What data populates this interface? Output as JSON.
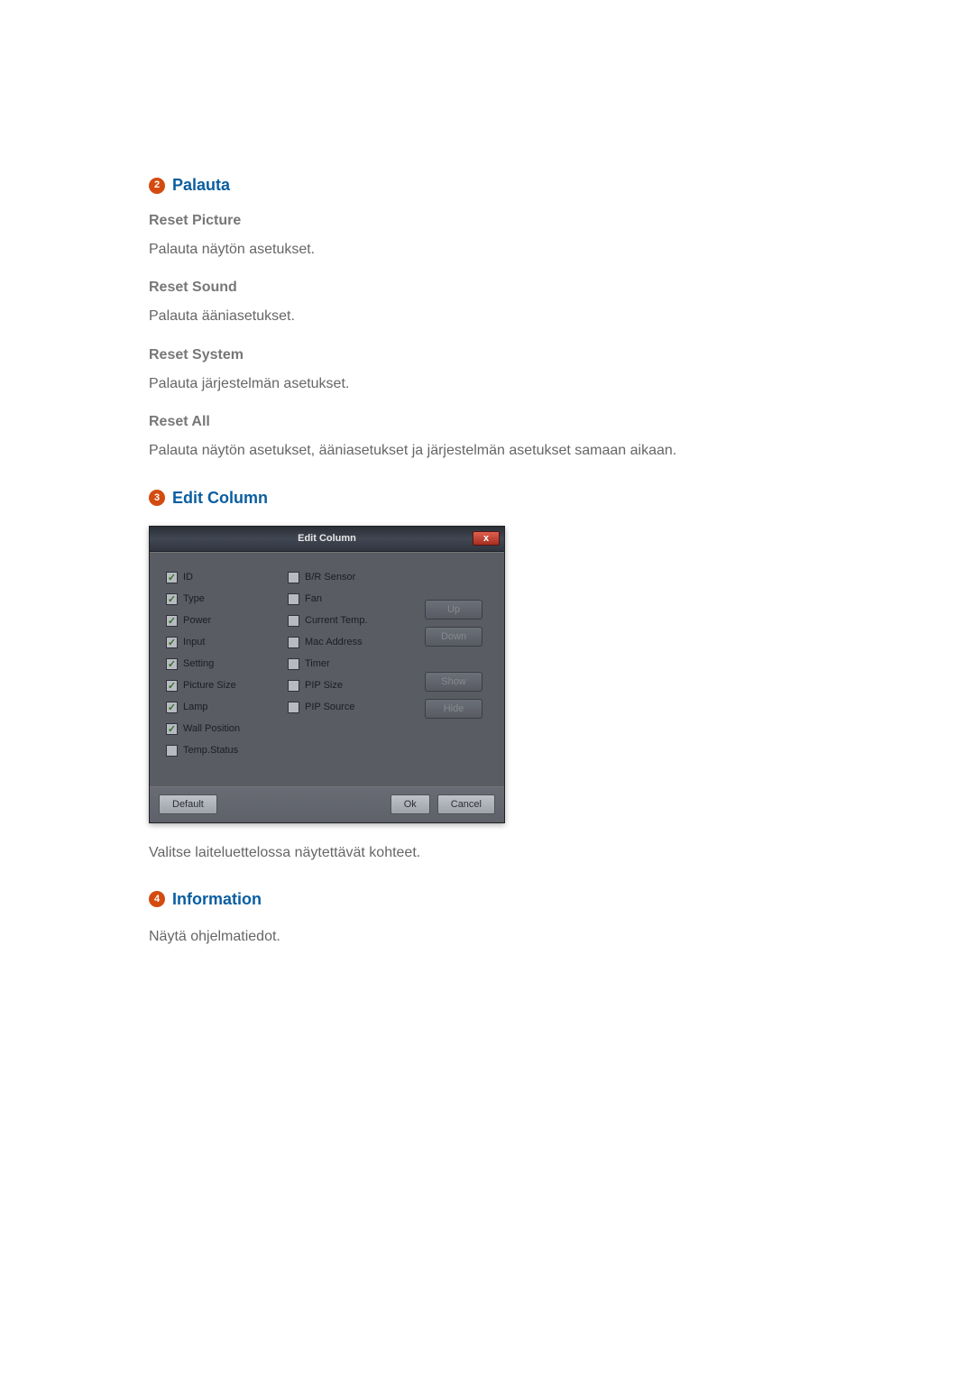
{
  "sections": {
    "reset": {
      "badge": "2",
      "title": "Palauta",
      "items": [
        {
          "heading": "Reset Picture",
          "body": "Palauta näytön asetukset."
        },
        {
          "heading": "Reset Sound",
          "body": "Palauta ääniasetukset."
        },
        {
          "heading": "Reset System",
          "body": "Palauta järjestelmän asetukset."
        },
        {
          "heading": "Reset All",
          "body": "Palauta näytön asetukset, ääniasetukset ja järjestelmän asetukset samaan aikaan."
        }
      ]
    },
    "editColumn": {
      "badge": "3",
      "title": "Edit Column",
      "caption": "Valitse laiteluettelossa näytettävät kohteet."
    },
    "information": {
      "badge": "4",
      "title": "Information",
      "body": "Näytä ohjelmatiedot."
    }
  },
  "dialog": {
    "title": "Edit Column",
    "close": "x",
    "leftColumn": [
      {
        "label": "ID",
        "checked": true
      },
      {
        "label": "Type",
        "checked": true
      },
      {
        "label": "Power",
        "checked": true
      },
      {
        "label": "Input",
        "checked": true
      },
      {
        "label": "Setting",
        "checked": true
      },
      {
        "label": "Picture Size",
        "checked": true
      },
      {
        "label": "Lamp",
        "checked": true
      },
      {
        "label": "Wall Position",
        "checked": true
      },
      {
        "label": "Temp.Status",
        "checked": false
      }
    ],
    "rightColumn": [
      {
        "label": "B/R Sensor",
        "checked": false
      },
      {
        "label": "Fan",
        "checked": false
      },
      {
        "label": "Current Temp.",
        "checked": false
      },
      {
        "label": "Mac Address",
        "checked": false
      },
      {
        "label": "Timer",
        "checked": false
      },
      {
        "label": "PIP Size",
        "checked": false
      },
      {
        "label": "PIP Source",
        "checked": false
      }
    ],
    "sideButtons": {
      "up": "Up",
      "down": "Down",
      "show": "Show",
      "hide": "Hide"
    },
    "footer": {
      "default": "Default",
      "ok": "Ok",
      "cancel": "Cancel"
    }
  }
}
